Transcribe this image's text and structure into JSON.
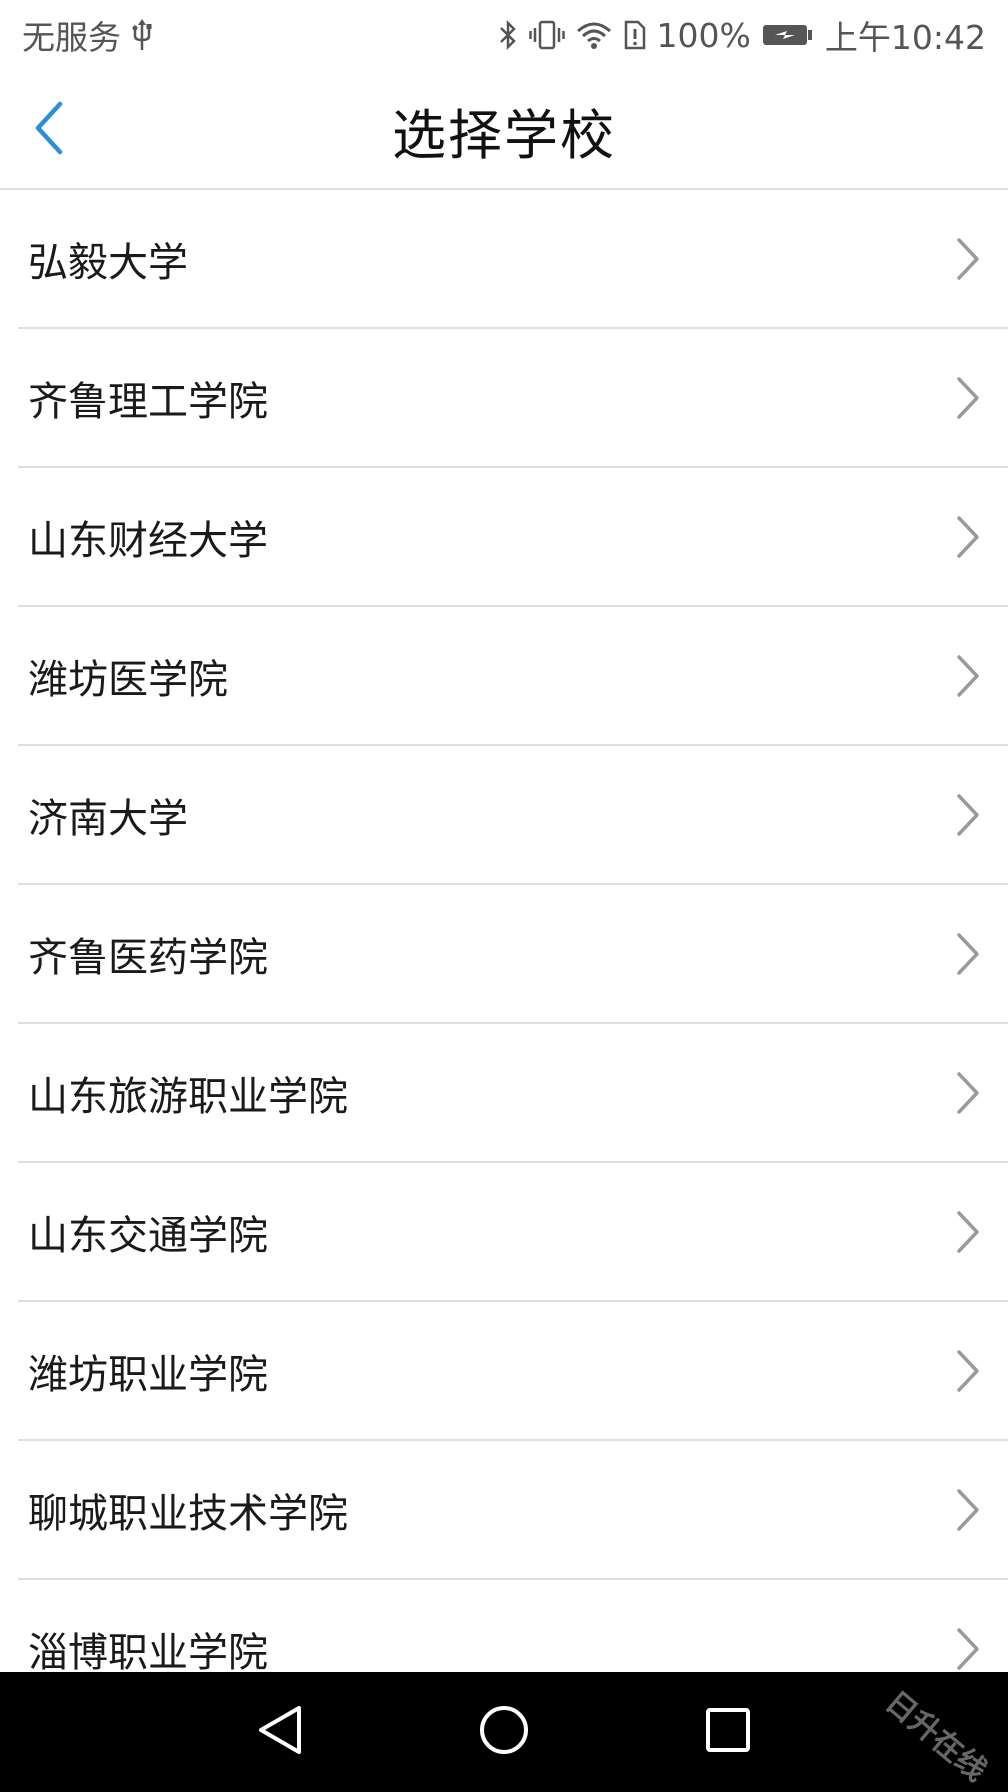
{
  "status_bar": {
    "carrier": "无服务",
    "battery_percent": "100%",
    "time": "上午10:42",
    "icons": [
      "usb-icon",
      "bluetooth-icon",
      "vibrate-icon",
      "wifi-icon",
      "alert-icon",
      "battery-charging-icon"
    ]
  },
  "header": {
    "title": "选择学校",
    "back_icon": "chevron-left-icon"
  },
  "schools": [
    {
      "name": "弘毅大学"
    },
    {
      "name": "齐鲁理工学院"
    },
    {
      "name": "山东财经大学"
    },
    {
      "name": "潍坊医学院"
    },
    {
      "name": "济南大学"
    },
    {
      "name": "齐鲁医药学院"
    },
    {
      "name": "山东旅游职业学院"
    },
    {
      "name": "山东交通学院"
    },
    {
      "name": "潍坊职业学院"
    },
    {
      "name": "聊城职业技术学院"
    },
    {
      "name": "淄博职业学院"
    }
  ],
  "system_nav": {
    "buttons": [
      "back-triangle-icon",
      "home-circle-icon",
      "recents-square-icon"
    ]
  },
  "watermark": "日升在线",
  "colors": {
    "accent": "#2b8fd6",
    "divider": "#dedede",
    "chevron": "#9a9a9a",
    "nav_bg": "#000000"
  }
}
